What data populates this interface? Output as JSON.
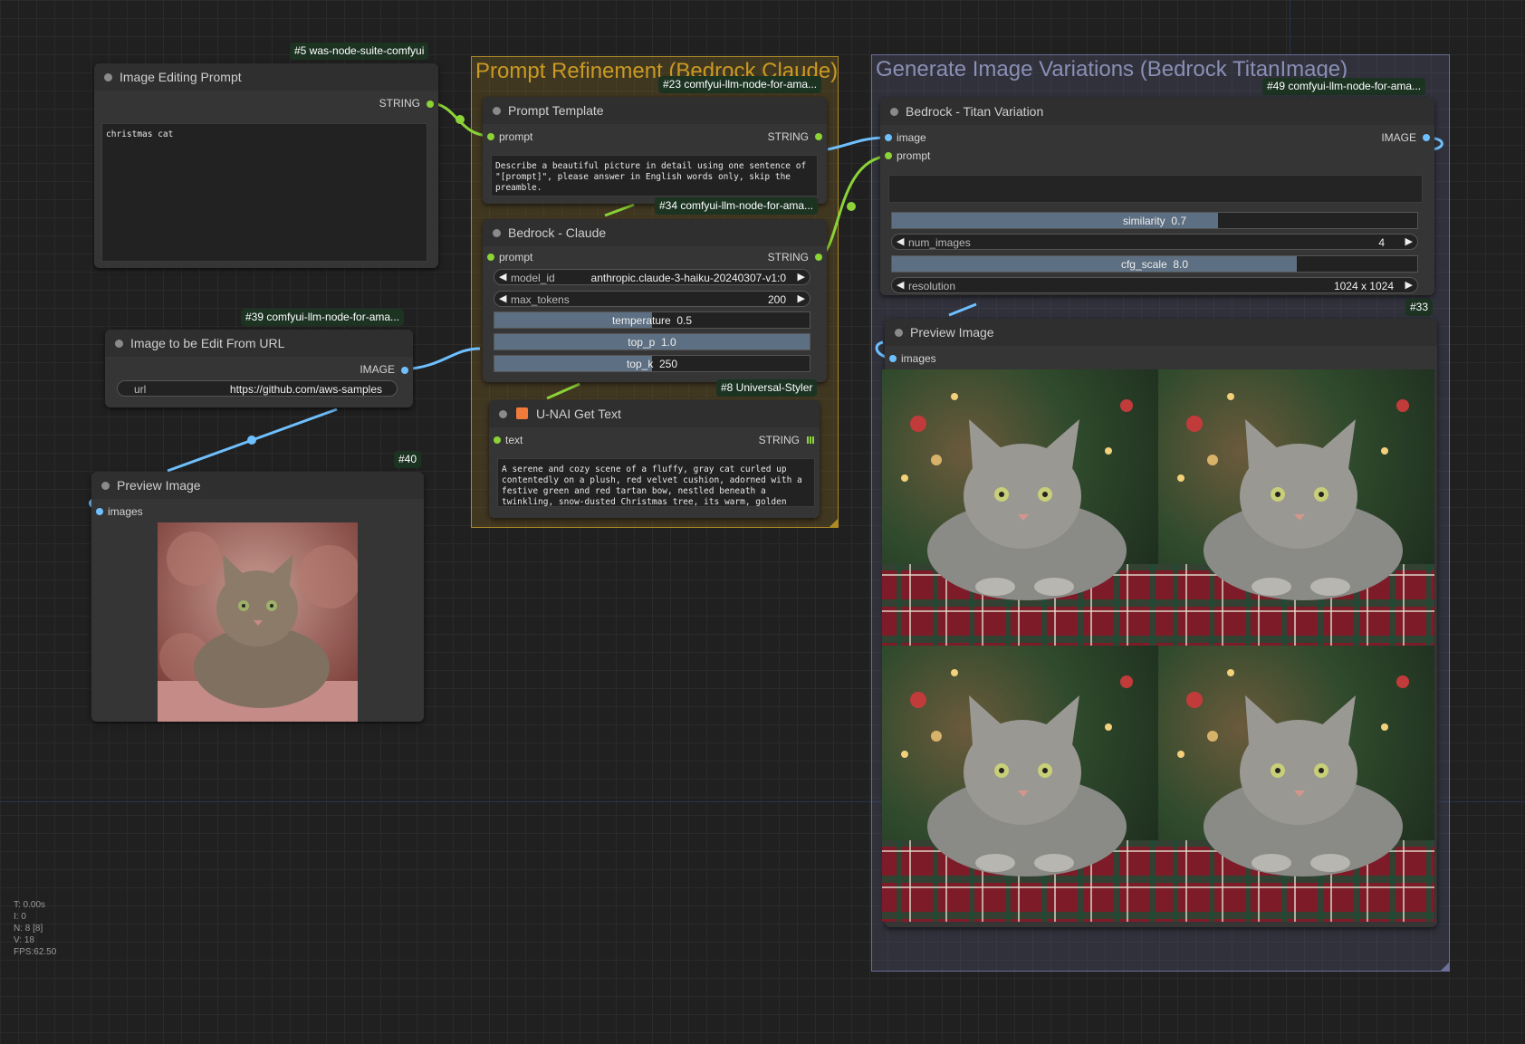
{
  "colors": {
    "background": "#202020",
    "string_slot": "#8bd336",
    "image_slot": "#6fc0ff",
    "group_prompt_refinement": "#b08a24",
    "group_generate_variations": "#6b6f9a",
    "badge_bg": "#1c3322"
  },
  "groups": {
    "prompt_refinement": {
      "title": "Prompt Refinement (Bedrock Claude)"
    },
    "generate_variations": {
      "title": "Generate Image Variations (Bedrock TitanImage)"
    }
  },
  "nodes": {
    "image_editing_prompt": {
      "badge": "#5 was-node-suite-comfyui",
      "title": "Image Editing Prompt",
      "output": "STRING",
      "text": "christmas cat"
    },
    "image_from_url": {
      "badge": "#39 comfyui-llm-node-for-ama...",
      "title": "Image to be Edit From URL",
      "output": "IMAGE",
      "url_label": "url",
      "url_value": "https://github.com/aws-samples"
    },
    "preview_image_40": {
      "badge": "#40",
      "title": "Preview Image",
      "input": "images",
      "image_icon": "fluffy-tabby-cat-photo"
    },
    "prompt_template": {
      "badge": "#23 comfyui-llm-node-for-ama...",
      "title": "Prompt Template",
      "input": "prompt",
      "output": "STRING",
      "text": "Describe a beautiful picture in detail using one sentence of \"[prompt]\", please answer in English words only, skip the preamble."
    },
    "bedrock_claude": {
      "badge": "#34 comfyui-llm-node-for-ama...",
      "title": "Bedrock - Claude",
      "input": "prompt",
      "output": "STRING",
      "model_label": "model_id",
      "model_value": "anthropic.claude-3-haiku-20240307-v1:0",
      "max_tokens_label": "max_tokens",
      "max_tokens_value": "200",
      "temperature_label": "temperature",
      "temperature_value": "0.5",
      "temperature_fraction": 0.5,
      "top_p_label": "top_p",
      "top_p_value": "1.0",
      "top_p_fraction": 1.0,
      "top_k_label": "top_k",
      "top_k_value": "250",
      "top_k_fraction": 0.5
    },
    "unai_get_text": {
      "badge": "#8 Universal-Styler",
      "title": "U-NAI Get Text",
      "input": "text",
      "output": "STRING",
      "text": "A serene and cozy scene of a fluffy, gray cat curled up contentedly on a plush, red velvet cushion, adorned with a festive green and red tartan bow, nestled beneath a twinkling, snow-dusted Christmas tree, its warm, golden lights casting a soft, inviting glow."
    },
    "titan_variation": {
      "badge": "#49 comfyui-llm-node-for-ama...",
      "title": "Bedrock - Titan Variation",
      "input_image": "image",
      "input_prompt": "prompt",
      "output": "IMAGE",
      "prompt_text": "",
      "similarity_label": "similarity",
      "similarity_value": "0.7",
      "similarity_fraction": 0.62,
      "num_images_label": "num_images",
      "num_images_value": "4",
      "cfg_scale_label": "cfg_scale",
      "cfg_scale_value": "8.0",
      "cfg_scale_fraction": 0.77,
      "resolution_label": "resolution",
      "resolution_value": "1024 x 1024"
    },
    "preview_image_33": {
      "badge": "#33",
      "title": "Preview Image",
      "input": "images",
      "image_icon": "four-christmas-cat-variations"
    }
  },
  "stats": {
    "t": "T: 0.00s",
    "i": "I: 0",
    "n": "N: 8 [8]",
    "v": "V: 18",
    "fps": "FPS:62.50"
  }
}
